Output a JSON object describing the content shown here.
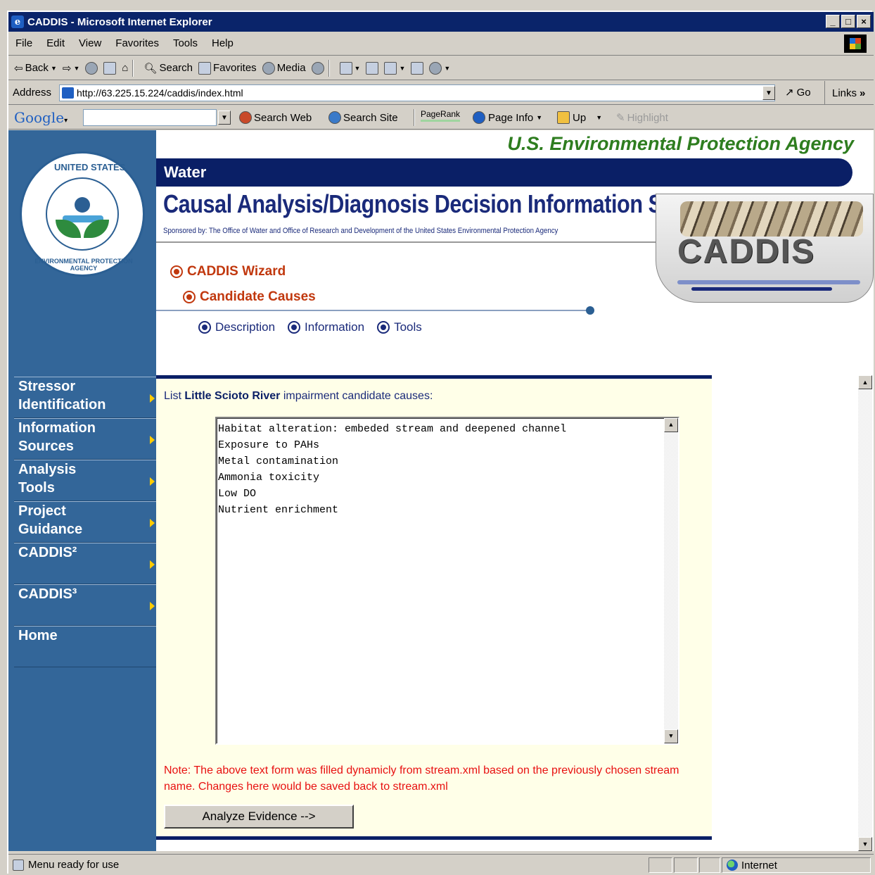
{
  "window": {
    "title": "CADDIS - Microsoft Internet Explorer",
    "controls": [
      "_",
      "□",
      "×"
    ]
  },
  "menubar": {
    "items": [
      "File",
      "Edit",
      "View",
      "Favorites",
      "Tools",
      "Help"
    ]
  },
  "toolbar": {
    "back_label": "Back",
    "search_label": "Search",
    "favorites_label": "Favorites",
    "media_label": "Media"
  },
  "addressbar": {
    "label": "Address",
    "url": "http://63.225.15.224/caddis/index.html",
    "go_label": "Go",
    "links_label": "Links"
  },
  "googlebar": {
    "logo": "Google",
    "search_web": "Search Web",
    "search_site": "Search Site",
    "pagerank": "PageRank",
    "page_info": "Page Info",
    "up": "Up",
    "highlight": "Highlight"
  },
  "header": {
    "agency": "U.S. Environmental Protection Agency",
    "section": "Water",
    "title": "Causal Analysis/Diagnosis Decision Information System",
    "sponsor": "Sponsored by: The Office of Water and Office of Research and Development of the United States Environmental Protection Agency",
    "logo_text": "CADDIS",
    "seal_top": "UNITED STATES",
    "seal_bottom": "ENVIRONMENTAL PROTECTION AGENCY"
  },
  "wizard": {
    "step1": "CADDIS Wizard",
    "step2": "Candidate Causes",
    "sub": [
      "Description",
      "Information",
      "Tools"
    ]
  },
  "sidebar": {
    "items": [
      {
        "label": "Stressor Identification",
        "arrow": true
      },
      {
        "label": "Information Sources",
        "arrow": true
      },
      {
        "label": "Analysis Tools",
        "arrow": true
      },
      {
        "label": "Project Guidance",
        "arrow": true
      },
      {
        "label": "CADDIS²",
        "arrow": true
      },
      {
        "label": "CADDIS³",
        "arrow": true
      },
      {
        "label": "Home",
        "arrow": false
      }
    ]
  },
  "main": {
    "list_prefix": "List",
    "river": "Little Scioto River",
    "list_suffix": "impairment candidate causes:",
    "causes": [
      "Habitat alteration: embeded stream and deepened channel",
      "Exposure to PAHs",
      "Metal contamination",
      "Ammonia toxicity",
      "Low DO",
      "Nutrient enrichment"
    ],
    "note": "Note: The above text form was filled dynamicly from stream.xml based on the previously chosen stream name. Changes here would be saved back to stream.xml",
    "analyze_button": "Analyze Evidence -->"
  },
  "statusbar": {
    "text": "Menu ready for use",
    "zone": "Internet"
  },
  "colors": {
    "titlebar": "#0a246a",
    "sidebar": "#336699",
    "navy_band": "#0a1f66",
    "agency_green": "#2e7d1f",
    "wizard_red": "#c1380e",
    "note_red": "#e81010",
    "panel_bg": "#ffffe8"
  }
}
